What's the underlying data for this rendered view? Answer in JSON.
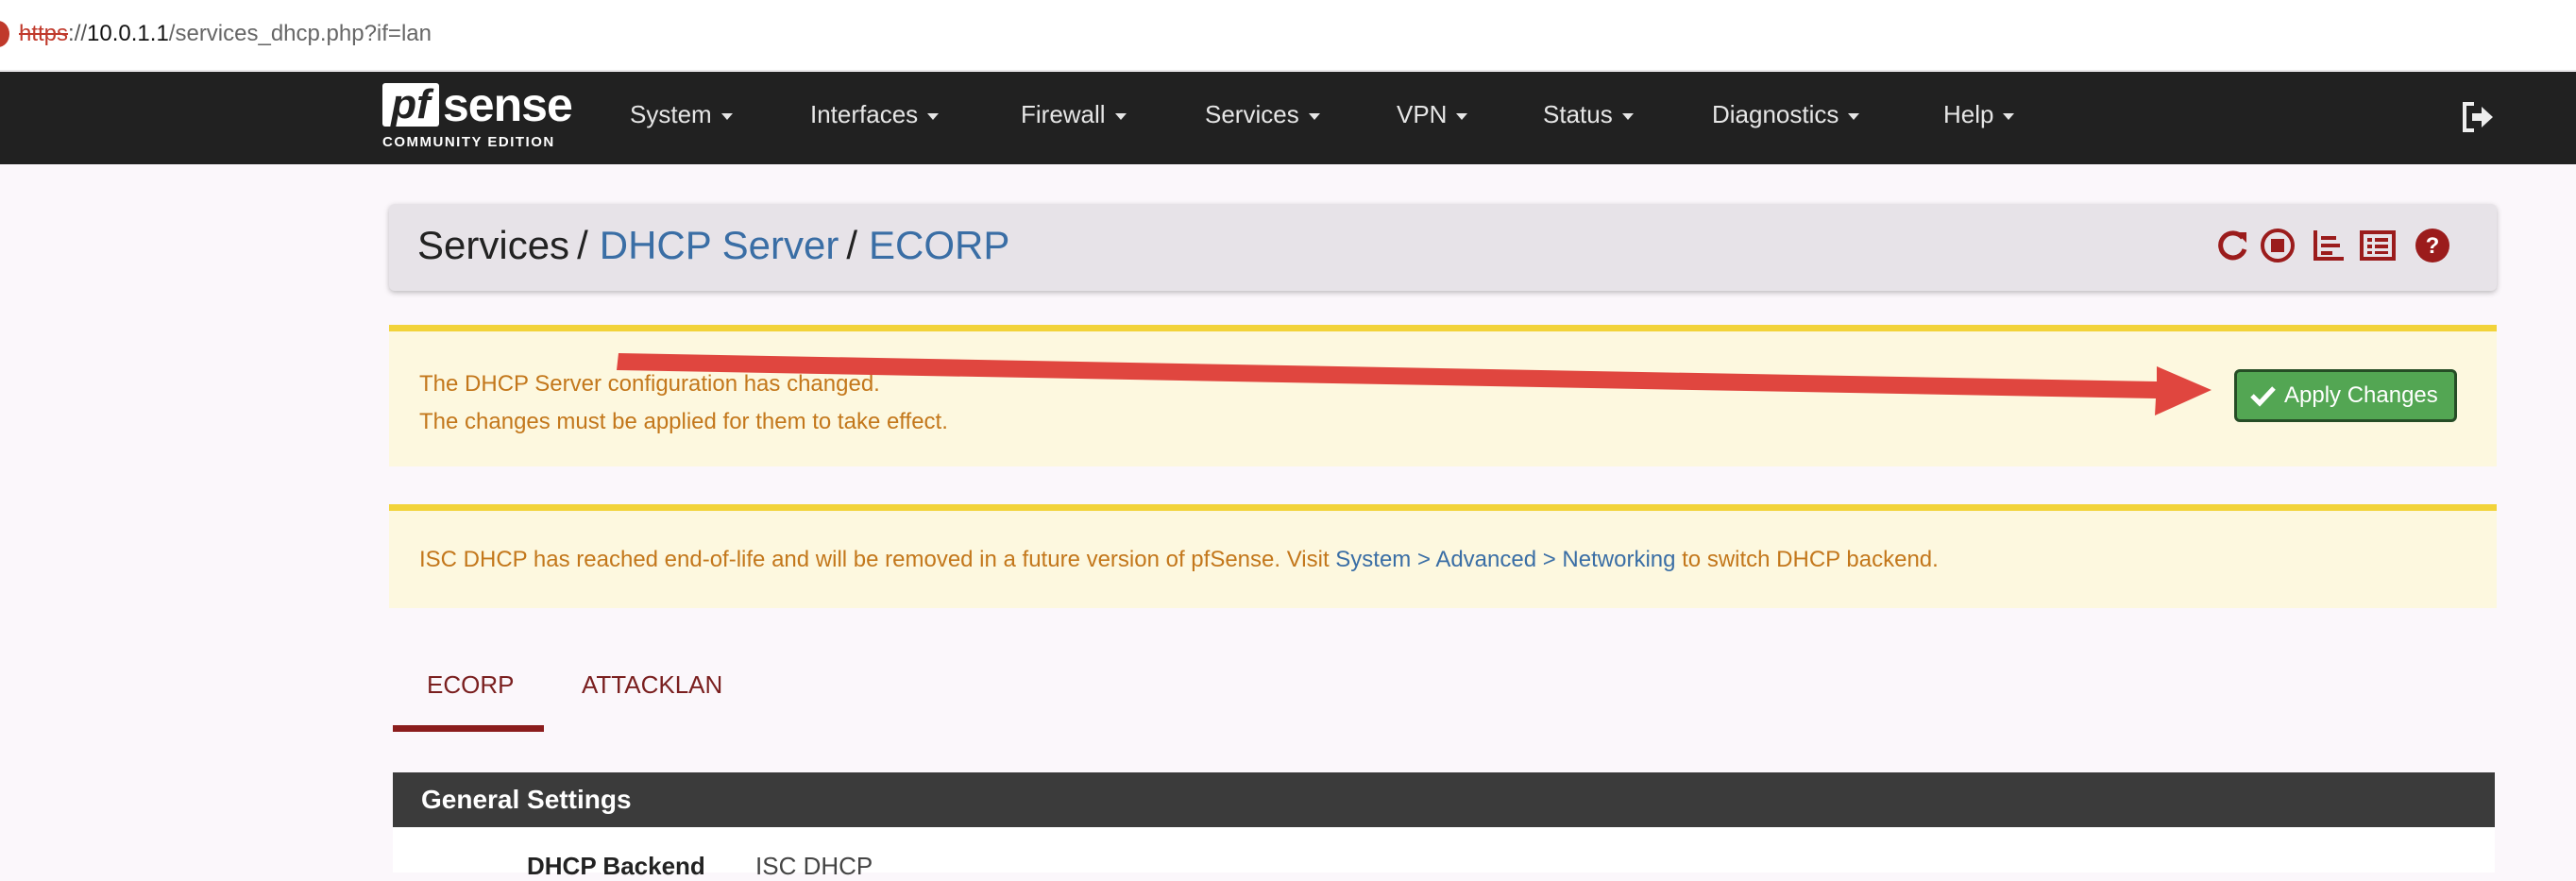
{
  "browser": {
    "url_protocol": "https",
    "url_separator": "://",
    "url_host": "10.0.1.1",
    "url_path": "/services_dhcp.php?if=lan"
  },
  "navbar": {
    "logo_pf": "pf",
    "logo_sense": "sense",
    "logo_edition": "COMMUNITY EDITION",
    "items": [
      {
        "label": "System"
      },
      {
        "label": "Interfaces"
      },
      {
        "label": "Firewall"
      },
      {
        "label": "Services"
      },
      {
        "label": "VPN"
      },
      {
        "label": "Status"
      },
      {
        "label": "Diagnostics"
      },
      {
        "label": "Help"
      }
    ],
    "logout_icon": "logout-icon"
  },
  "breadcrumb": {
    "level1": "Services",
    "level2": "DHCP Server",
    "level3": "ECORP",
    "separator": "/",
    "icons": [
      "reload-icon",
      "stop-icon",
      "chart-icon",
      "log-icon",
      "help-icon"
    ]
  },
  "alerts": {
    "config_changed_line1": "The DHCP Server configuration has changed.",
    "config_changed_line2": "The changes must be applied for them to take effect.",
    "apply_button": "Apply Changes",
    "eol_prefix": "ISC DHCP has reached end-of-life and will be removed in a future version of pfSense. Visit ",
    "eol_link": "System > Advanced > Networking",
    "eol_suffix": " to switch DHCP backend."
  },
  "tabs": [
    {
      "label": "ECORP",
      "active": true
    },
    {
      "label": "ATTACKLAN",
      "active": false
    }
  ],
  "general_settings": {
    "title": "General Settings",
    "backend_label": "DHCP Backend",
    "backend_value": "ISC DHCP"
  },
  "colors": {
    "navbar": "#212121",
    "alert_border": "#f2d33a",
    "alert_text": "#c3771b",
    "link": "#3a6ea5",
    "apply_button": "#53a653",
    "tab_accent": "#8b1d1d",
    "annotation_arrow": "#e0463f"
  }
}
